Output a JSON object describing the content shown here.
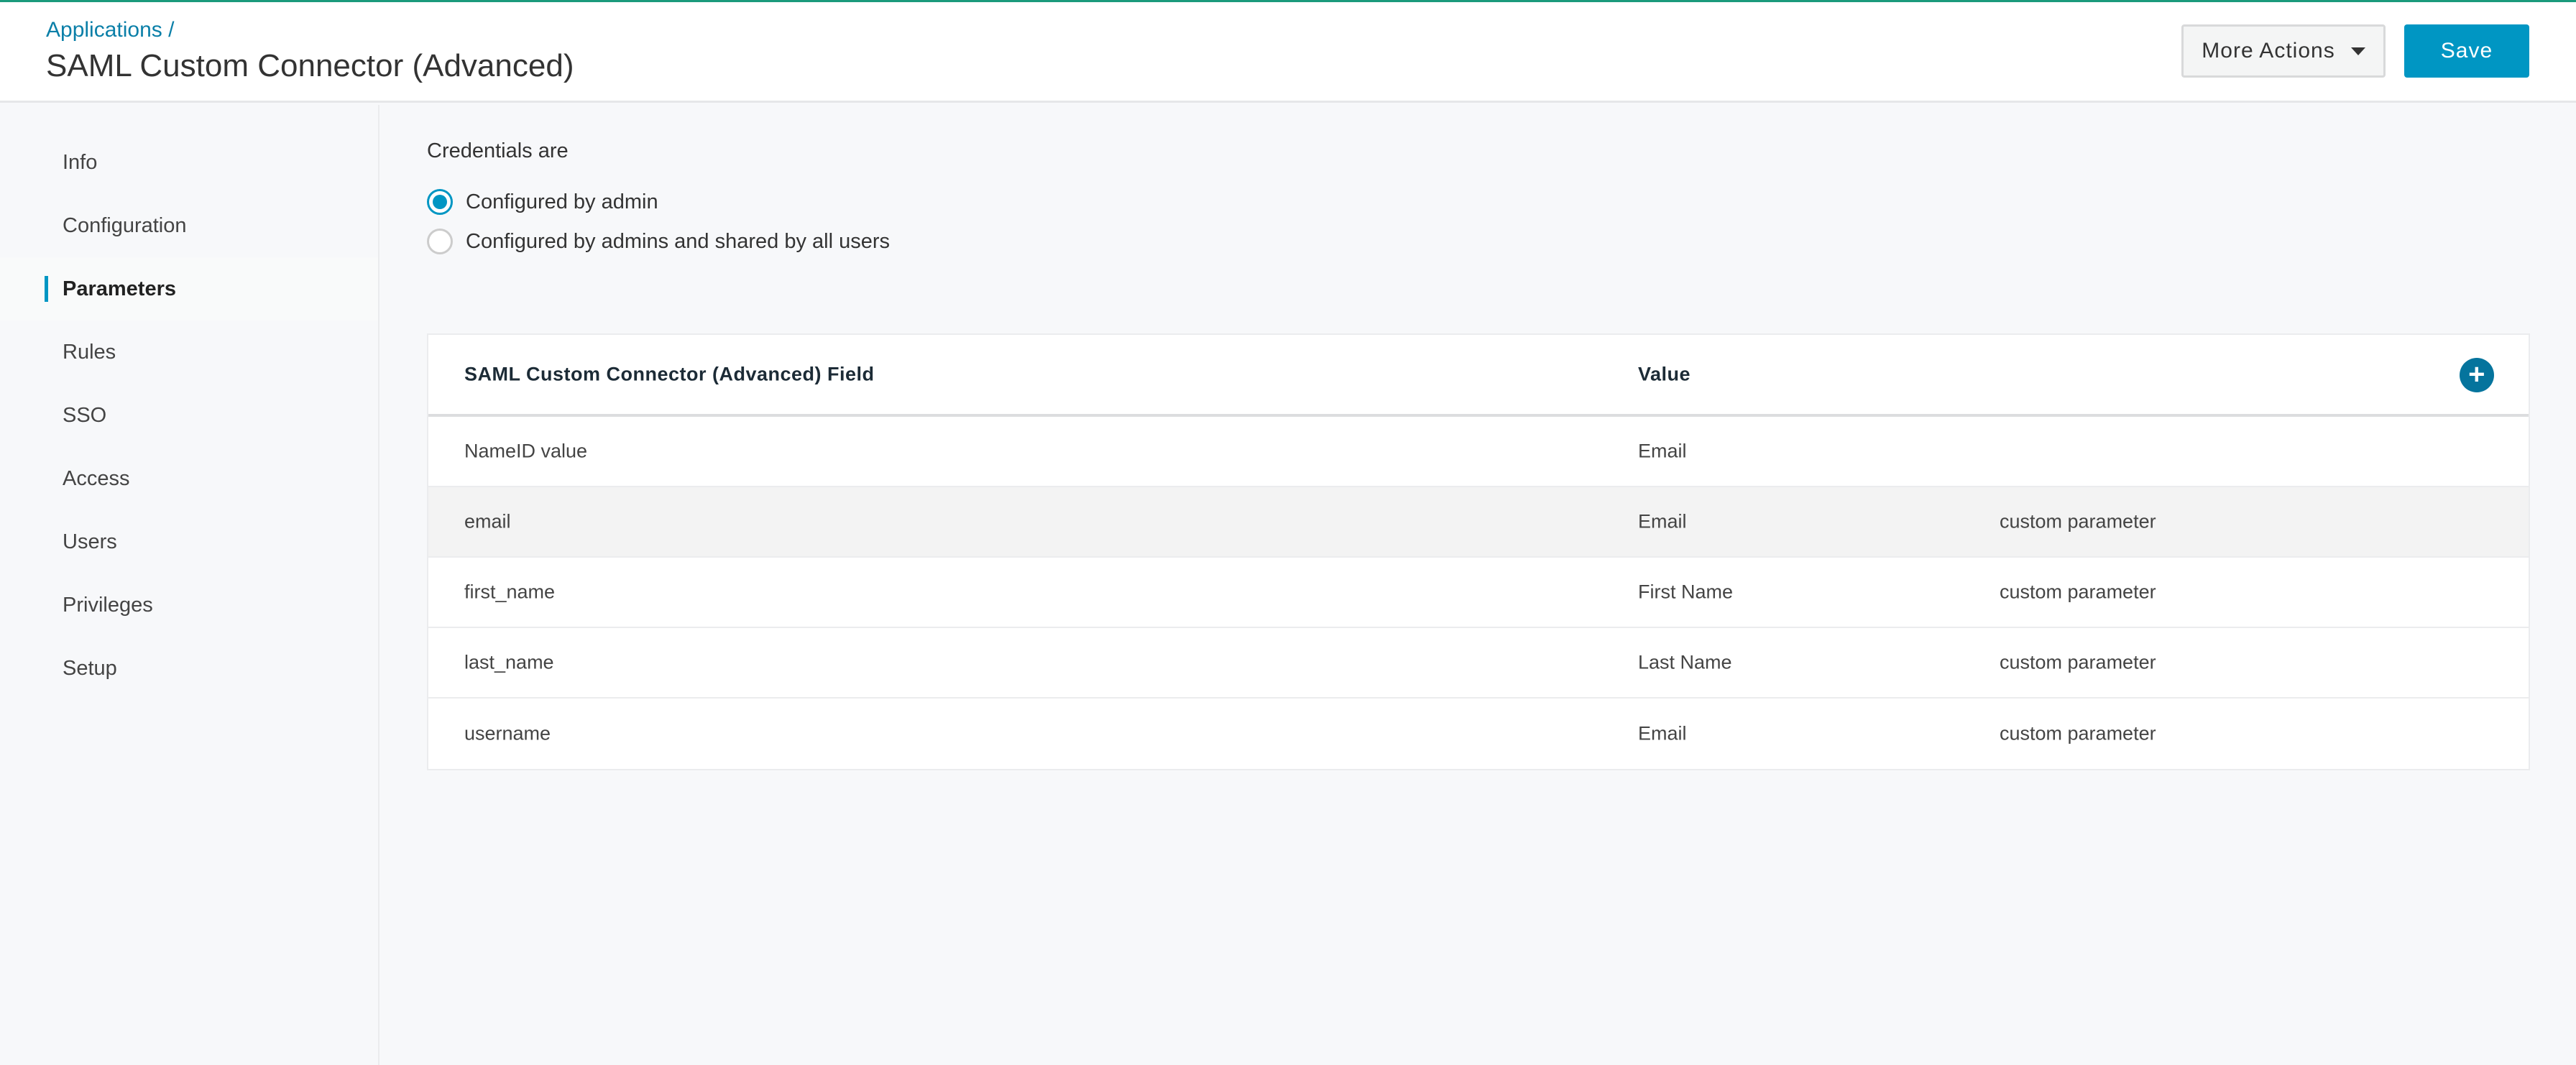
{
  "header": {
    "breadcrumb": "Applications /",
    "title": "SAML Custom Connector (Advanced)",
    "more_actions": "More Actions",
    "save": "Save"
  },
  "colors": {
    "accent": "#0096c3",
    "add_button": "#05749d",
    "top_line": "#1a9a7c"
  },
  "sidebar": {
    "active": "Parameters",
    "items": [
      {
        "label": "Info"
      },
      {
        "label": "Configuration"
      },
      {
        "label": "Parameters"
      },
      {
        "label": "Rules"
      },
      {
        "label": "SSO"
      },
      {
        "label": "Access"
      },
      {
        "label": "Users"
      },
      {
        "label": "Privileges"
      },
      {
        "label": "Setup"
      }
    ]
  },
  "credentials": {
    "label": "Credentials are",
    "options": [
      {
        "label": "Configured by admin",
        "selected": true
      },
      {
        "label": "Configured by admins and shared by all users",
        "selected": false
      }
    ]
  },
  "table": {
    "headers": [
      "SAML Custom Connector (Advanced) Field",
      "Value"
    ],
    "rows": [
      {
        "field": "NameID value",
        "value": "Email",
        "type": ""
      },
      {
        "field": "email",
        "value": "Email",
        "type": "custom parameter"
      },
      {
        "field": "first_name",
        "value": "First Name",
        "type": "custom parameter"
      },
      {
        "field": "last_name",
        "value": "Last Name",
        "type": "custom parameter"
      },
      {
        "field": "username",
        "value": "Email",
        "type": "custom parameter"
      }
    ]
  }
}
